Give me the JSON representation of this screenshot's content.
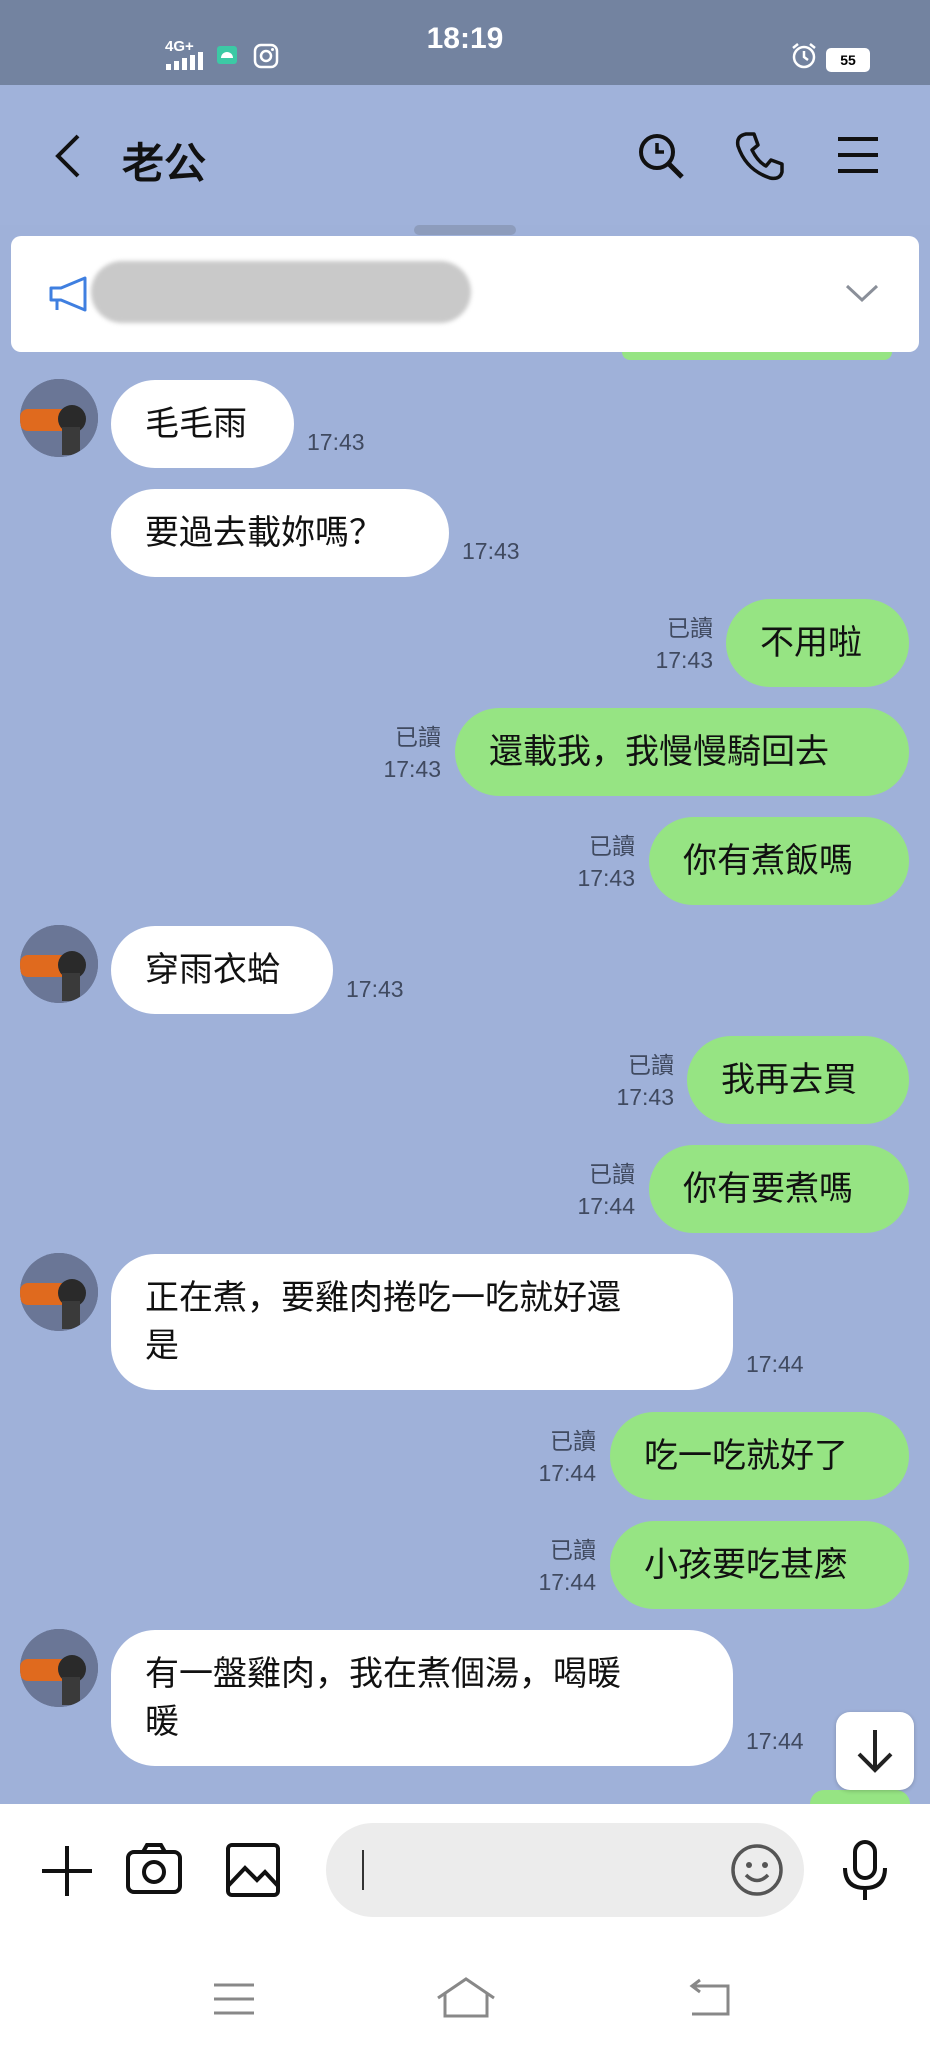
{
  "status_bar": {
    "time": "18:19",
    "network": "4G+",
    "battery": "55"
  },
  "header": {
    "title": "老公"
  },
  "messages": [
    {
      "dir": "in",
      "text": "毛毛雨",
      "time": "17:43"
    },
    {
      "dir": "in",
      "text": "要過去載妳嗎？",
      "time": "17:43"
    },
    {
      "dir": "out",
      "text": "不用啦",
      "read": "已讀",
      "time": "17:43"
    },
    {
      "dir": "out",
      "text": "還載我，我慢慢騎回去",
      "read": "已讀",
      "time": "17:43"
    },
    {
      "dir": "out",
      "text": "你有煮飯嗎",
      "read": "已讀",
      "time": "17:43"
    },
    {
      "dir": "in",
      "text": "穿雨衣蛤",
      "time": "17:43"
    },
    {
      "dir": "out",
      "text": "我再去買",
      "read": "已讀",
      "time": "17:43"
    },
    {
      "dir": "out",
      "text": "你有要煮嗎",
      "read": "已讀",
      "time": "17:44"
    },
    {
      "dir": "in",
      "text": "正在煮，要雞肉捲吃一吃就好還是",
      "line1": "正在煮，要雞肉捲吃一吃就好還",
      "line2": "是",
      "time": "17:44"
    },
    {
      "dir": "out",
      "text": "吃一吃就好了",
      "read": "已讀",
      "time": "17:44"
    },
    {
      "dir": "out",
      "text": "小孩要吃甚麼",
      "read": "已讀",
      "time": "17:44"
    },
    {
      "dir": "in",
      "text": "有一盤雞肉，我在煮個湯，喝暖暖",
      "line1": "有一盤雞肉，我在煮個湯，喝暖",
      "line2": "暖",
      "time": "17:44"
    }
  ],
  "colors": {
    "chat_bg": "#9fb1d9",
    "outgoing_bubble": "#96e483",
    "incoming_bubble": "#ffffff"
  }
}
